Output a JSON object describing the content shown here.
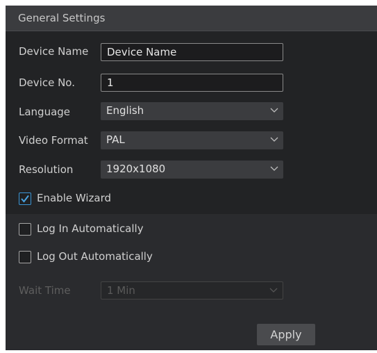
{
  "header": {
    "title": "General Settings"
  },
  "fields": {
    "device_name": {
      "label": "Device Name",
      "value": "Device Name"
    },
    "device_no": {
      "label": "Device No.",
      "value": "1"
    },
    "language": {
      "label": "Language",
      "value": "English"
    },
    "video_format": {
      "label": "Video Format",
      "value": "PAL"
    },
    "resolution": {
      "label": "Resolution",
      "value": "1920x1080"
    },
    "wait_time": {
      "label": "Wait Time",
      "value": "1 Min",
      "disabled": true
    }
  },
  "checkboxes": {
    "enable_wizard": {
      "label": "Enable Wizard",
      "checked": true
    },
    "log_in_auto": {
      "label": "Log In Automatically",
      "checked": false
    },
    "log_out_auto": {
      "label": "Log Out Automatically",
      "checked": false
    }
  },
  "actions": {
    "apply_label": "Apply"
  },
  "colors": {
    "panel_bg": "#222325",
    "header_bg": "#3b3c3f",
    "accent": "#3b96d6"
  }
}
